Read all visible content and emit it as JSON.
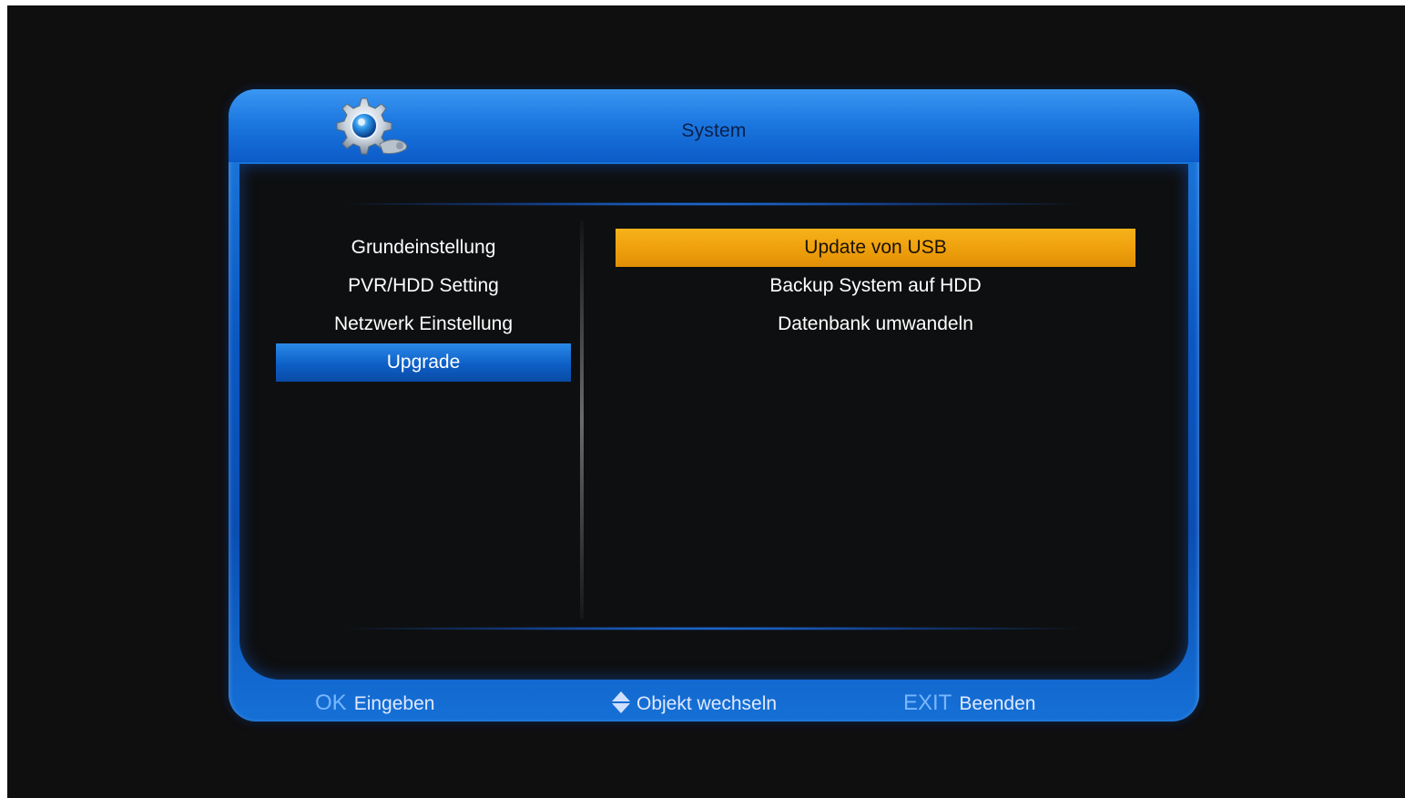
{
  "window": {
    "title": "System",
    "logo_icon": "gear-settings-icon"
  },
  "left_menu": {
    "items": [
      {
        "label": "Grundeinstellung",
        "selected": false
      },
      {
        "label": "PVR/HDD Setting",
        "selected": false
      },
      {
        "label": "Netzwerk Einstellung",
        "selected": false
      },
      {
        "label": "Upgrade",
        "selected": true
      }
    ]
  },
  "right_menu": {
    "items": [
      {
        "label": "Update von USB",
        "selected": true
      },
      {
        "label": "Backup System auf HDD",
        "selected": false
      },
      {
        "label": "Datenbank umwandeln",
        "selected": false
      }
    ]
  },
  "footer": {
    "ok_key": "OK",
    "ok_label": "Eingeben",
    "move_icon": "up-down-arrow-icon",
    "move_label": "Objekt wechseln",
    "exit_key": "EXIT",
    "exit_label": "Beenden"
  },
  "colors": {
    "frame_blue": "#0b57c2",
    "selected_orange": "#efa10d",
    "selected_blue": "#0d5fc6",
    "background": "#0f0f10"
  }
}
